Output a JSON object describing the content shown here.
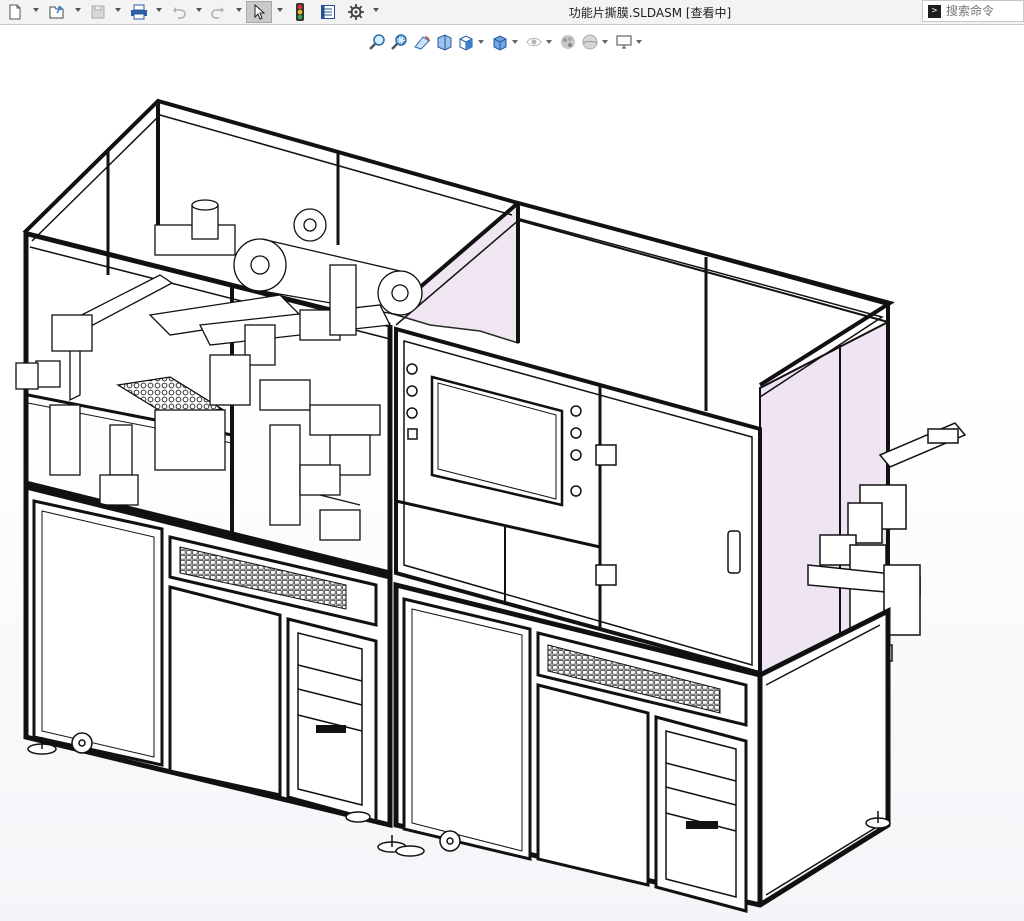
{
  "window": {
    "title": "功能片撕膜.SLDASM [查看中]",
    "search_placeholder": "搜索命令"
  },
  "toolbar": {
    "items": [
      "new-document-icon",
      "open-file-icon",
      "save-icon",
      "print-icon",
      "undo-icon",
      "redo-icon",
      "select-cursor-icon",
      "rebuild-traffic-light-icon",
      "file-properties-icon",
      "options-gear-icon"
    ]
  },
  "heads_up_toolbar": {
    "items": [
      "zoom-to-fit-icon",
      "zoom-to-area-icon",
      "previous-view-icon",
      "section-view-icon",
      "view-orientation-icon",
      "display-style-icon",
      "hide-show-items-icon",
      "edit-appearance-icon",
      "apply-scene-icon",
      "view-settings-icon"
    ]
  },
  "model": {
    "name": "功能片撕膜",
    "panel_tint": "#efe4f1",
    "frame_color": "#111111"
  }
}
